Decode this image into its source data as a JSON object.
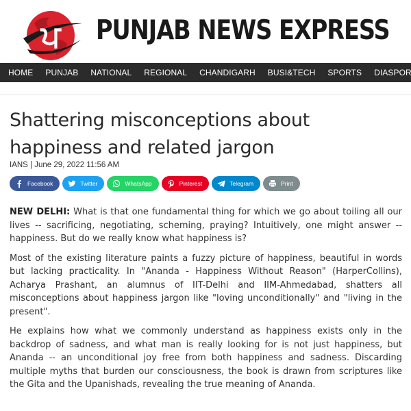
{
  "site": {
    "logo_letter": "ਪ",
    "brand_name": "PUNJAB NEWS EXPRESS",
    "logo_icon": "punjab-news-express-logo"
  },
  "nav": {
    "items": [
      "HOME",
      "PUNJAB",
      "NATIONAL",
      "REGIONAL",
      "CHANDIGARH",
      "BUSI&TECH",
      "SPORTS",
      "DIASPORA"
    ]
  },
  "article": {
    "title": "Shattering misconceptions about happiness and related jargon",
    "byline": "IANS | June 29, 2022 11:56 AM",
    "dateline": "NEW DELHI:",
    "paragraphs": [
      " What is that one fundamental thing for which we go about toiling all our lives -- sacrificing, negotiating, scheming, praying? Intuitively, one might answer -- happiness. But do we really know what happiness is?",
      "Most of the existing literature paints a fuzzy picture of happiness, beautiful in words but lacking practicality. In \"Ananda - Happiness Without Reason\" (HarperCollins), Acharya Prashant, an alumnus of IIT-Delhi and IIM-Ahmedabad, shatters all misconceptions about happiness jargon like \"loving unconditionally\" and \"living in the present\".",
      "He explains how what we commonly understand as happiness exists only in the backdrop of sadness, and what man is really looking for is not just happiness, but Ananda -- an unconditional joy free from both happiness and sadness. Discarding multiple myths that burden our consciousness, the book is drawn from scriptures like the Gita and the Upanishads, revealing the true meaning of Ananda."
    ]
  },
  "share": {
    "buttons": [
      {
        "label": "Facebook",
        "icon": "facebook-icon",
        "color": "#3b5998"
      },
      {
        "label": "Twitter",
        "icon": "twitter-icon",
        "color": "#1da1f2"
      },
      {
        "label": "WhatsApp",
        "icon": "whatsapp-icon",
        "color": "#25d366"
      },
      {
        "label": "Pinterest",
        "icon": "pinterest-icon",
        "color": "#e60023"
      },
      {
        "label": "Telegram",
        "icon": "telegram-icon",
        "color": "#0088cc"
      },
      {
        "label": "Print",
        "icon": "print-icon",
        "color": "#7f8c8d"
      }
    ]
  },
  "colors": {
    "nav_background": "#2b2b2b",
    "logo_red": "#d9232d",
    "logo_dark": "#1a1a1a"
  }
}
